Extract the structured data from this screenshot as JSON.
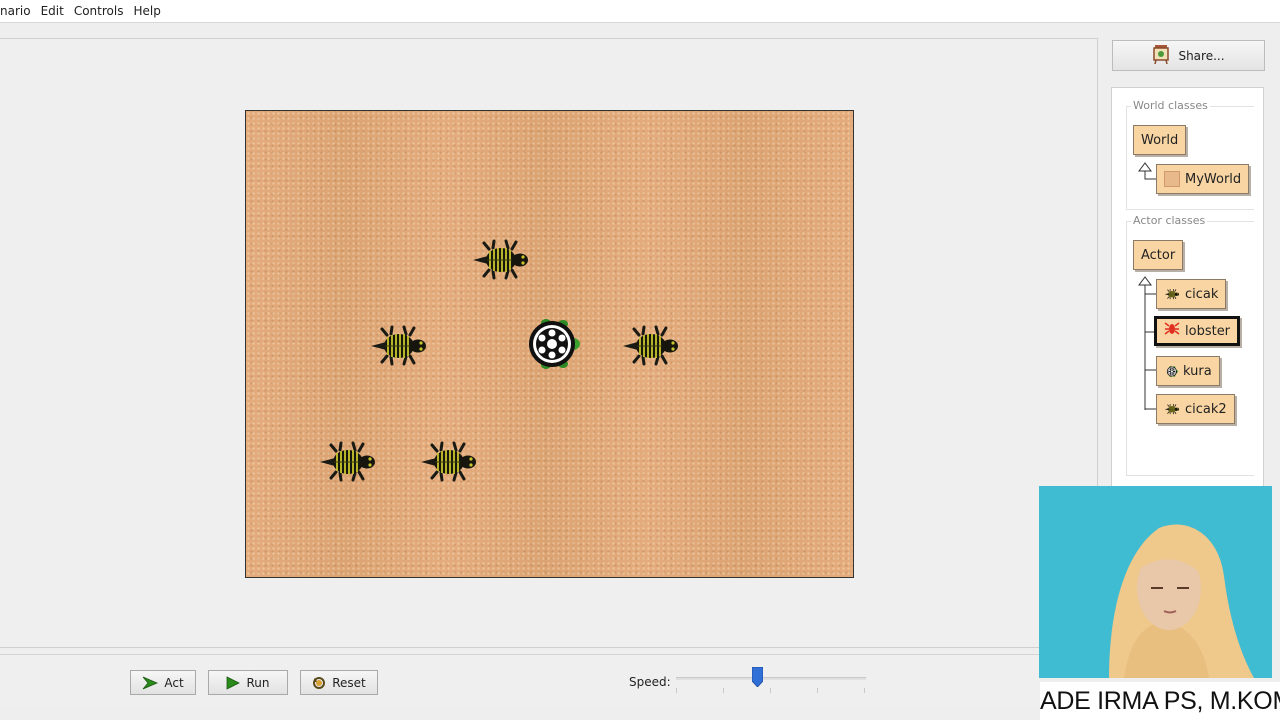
{
  "menubar": {
    "items": [
      "cenario",
      "Edit",
      "Controls",
      "Help"
    ]
  },
  "world": {
    "background": "#e3a876",
    "actors": [
      "cicak",
      "cicak",
      "cicak",
      "kura",
      "cicak",
      "cicak",
      "cicak"
    ]
  },
  "sidebar": {
    "share_label": "Share...",
    "world_classes_title": "World classes",
    "world_classes": [
      {
        "label": "World"
      },
      {
        "label": "MyWorld"
      }
    ],
    "actor_classes_title": "Actor classes",
    "actor_classes": [
      {
        "label": "Actor"
      },
      {
        "label": "cicak",
        "icon": "lizard-icon"
      },
      {
        "label": "lobster",
        "icon": "lobster-icon",
        "selected": true
      },
      {
        "label": "kura",
        "icon": "turtle-icon"
      },
      {
        "label": "cicak2",
        "icon": "lizard-icon"
      }
    ]
  },
  "controls": {
    "act_label": "Act",
    "run_label": "Run",
    "reset_label": "Reset",
    "speed_label": "Speed:",
    "speed_value": 0.43
  },
  "overlay": {
    "caption": "ADE IRMA PS, M.KOM"
  },
  "colors": {
    "class_box": "#f9d5a3",
    "accent_green": "#2a8a1a",
    "slider_thumb": "#2f6fd6"
  }
}
